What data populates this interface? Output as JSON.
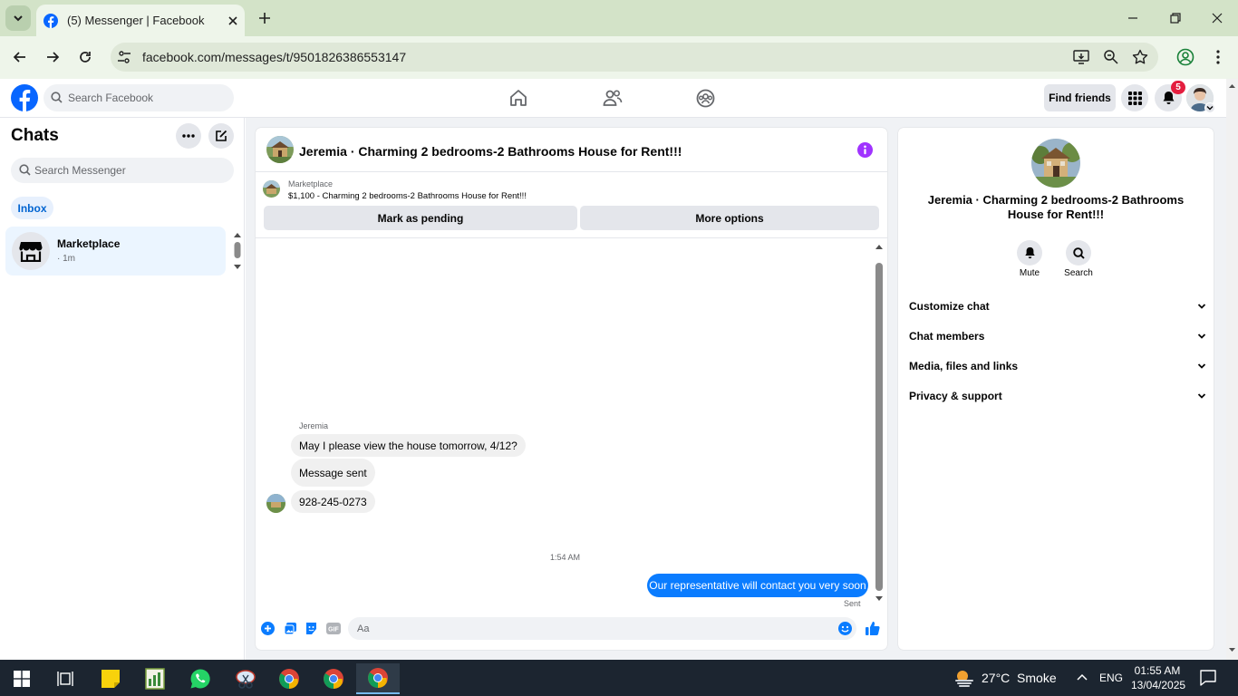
{
  "browser": {
    "tab_title": "(5) Messenger | Facebook",
    "url": "facebook.com/messages/t/9501826386553147"
  },
  "facebook": {
    "search_placeholder": "Search Facebook",
    "find_friends": "Find friends",
    "notification_count": "5"
  },
  "sidebar": {
    "title": "Chats",
    "search_placeholder": "Search Messenger",
    "filter": "Inbox",
    "chats": [
      {
        "name": "Marketplace",
        "time": "· 1m"
      }
    ]
  },
  "conversation": {
    "title": "Jeremia · Charming 2 bedrooms-2 Bathrooms House for Rent!!!",
    "listing": {
      "source": "Marketplace",
      "summary": "$1,100 - Charming 2 bedrooms-2 Bathrooms House for Rent!!!"
    },
    "actions": {
      "mark_pending": "Mark as pending",
      "more_options": "More options"
    },
    "messages": {
      "sender": "Jeremia",
      "incoming": [
        "May I please view the house tomorrow, 4/12?",
        "Message sent",
        "928-245-0273"
      ],
      "timestamp": "1:54 AM",
      "outgoing": "Our representative will contact you very soon",
      "status": "Sent"
    },
    "composer_placeholder": "Aa"
  },
  "info_panel": {
    "title": "Jeremia · Charming 2 bedrooms-2 Bathrooms House for Rent!!!",
    "mute_label": "Mute",
    "search_label": "Search",
    "sections": [
      "Customize chat",
      "Chat members",
      "Media, files and links",
      "Privacy & support"
    ]
  },
  "taskbar": {
    "weather": "27°C  Smoke",
    "language": "ENG",
    "time": "01:55 AM",
    "date": "13/04/2025"
  },
  "colors": {
    "brand": "#0866ff",
    "messenger_blue": "#0a7cff",
    "purple_info": "#a033ff",
    "badge_red": "#e41e3f"
  }
}
